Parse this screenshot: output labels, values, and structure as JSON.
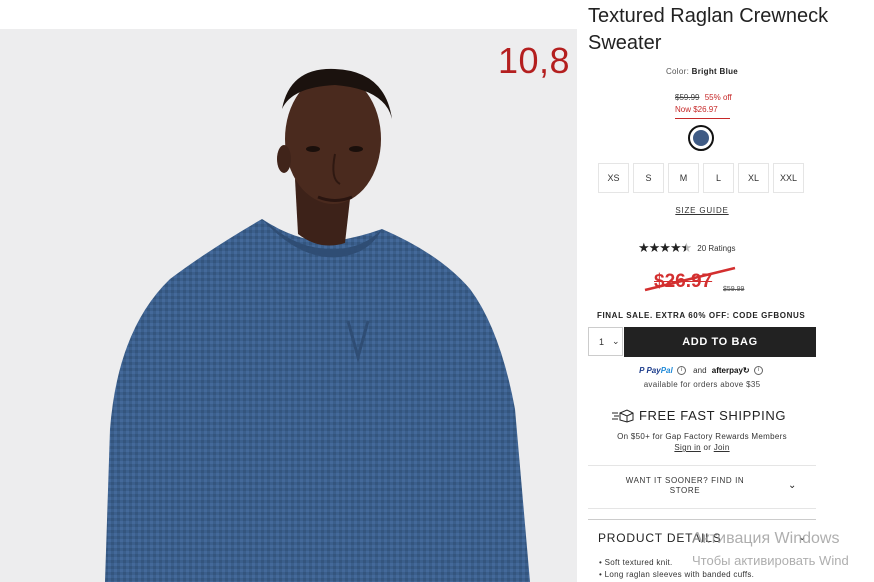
{
  "overlay_price": "10,8",
  "product": {
    "title": "Textured Raglan Crewneck Sweater",
    "color_label": "Color:",
    "color_value": "Bright Blue",
    "original_price": "$59.99",
    "discount": "55% off",
    "now_price": "Now $26.97",
    "swatch_color": "#3f5b85",
    "sizes": [
      "XS",
      "S",
      "M",
      "L",
      "XL",
      "XXL"
    ],
    "size_guide": "SIZE GUIDE",
    "stars": "★★★★",
    "half_star": "★",
    "ratings": "20 Ratings",
    "rating_value": 4.5,
    "big_price": "$26.97",
    "small_was": "$59.99",
    "final_sale": "FINAL SALE. EXTRA 60% OFF: CODE GFBONUS",
    "quantity": "1",
    "add_to_bag": "ADD TO BAG"
  },
  "payment": {
    "paypal_a": "Pay",
    "paypal_b": "Pal",
    "and": "and",
    "afterpay": "afterpay",
    "afterpay_mark": "↻",
    "info": "i",
    "sub": "available for orders above $35"
  },
  "shipping": {
    "title": "FREE FAST SHIPPING",
    "sub": "On $50+ for Gap Factory Rewards Members",
    "sign_in": "Sign in",
    "or": "or",
    "join": "Join"
  },
  "sooner": {
    "label": "WANT IT SOONER? FIND IN STORE",
    "chevron": "⌄"
  },
  "details": {
    "heading": "PRODUCT DETAILS",
    "chevron": "⌄",
    "bullets": [
      "Soft textured knit.",
      "Long raglan sleeves with banded cuffs."
    ]
  },
  "windows_watermark": {
    "line1": "Активация Windows",
    "line2": "Чтобы активировать Wind"
  },
  "accent_colors": {
    "sale_red": "#d32f2f",
    "button_dark": "#222222"
  }
}
